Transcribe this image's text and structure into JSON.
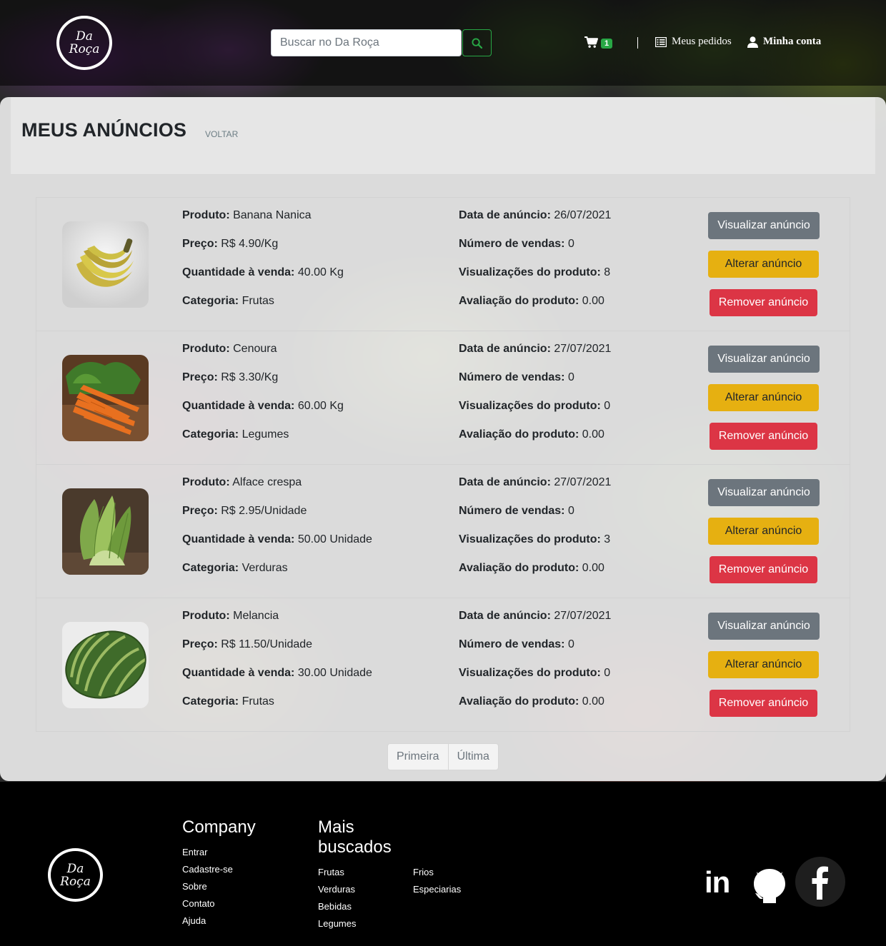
{
  "brand": {
    "line1": "Da",
    "line2": "Roça"
  },
  "header": {
    "search_placeholder": "Buscar no Da Roça",
    "cart_count": "1",
    "orders_label": "Meus pedidos",
    "account_label": "Minha conta"
  },
  "page": {
    "title": "MEUS ANÚNCIOS",
    "back": "VOLTAR"
  },
  "labels": {
    "product": "Produto:",
    "price": "Preço:",
    "quantity": "Quantidade à venda:",
    "category": "Categoria:",
    "date": "Data de anúncio:",
    "sales": "Número de vendas:",
    "views": "Visualizações do produto:",
    "rating": "Avaliação do produto:"
  },
  "buttons": {
    "view": "Visualizar anúncio",
    "edit": "Alterar anúncio",
    "remove": "Remover anúncio"
  },
  "ads": [
    {
      "product": "Banana Nanica",
      "price": "R$ 4.90/Kg",
      "quantity": "40.00 Kg",
      "category": "Frutas",
      "date": "26/07/2021",
      "sales": "0",
      "views": "8",
      "rating": "0.00"
    },
    {
      "product": "Cenoura",
      "price": "R$ 3.30/Kg",
      "quantity": "60.00 Kg",
      "category": "Legumes",
      "date": "27/07/2021",
      "sales": "0",
      "views": "0",
      "rating": "0.00"
    },
    {
      "product": "Alface crespa",
      "price": "R$ 2.95/Unidade",
      "quantity": "50.00 Unidade",
      "category": "Verduras",
      "date": "27/07/2021",
      "sales": "0",
      "views": "3",
      "rating": "0.00"
    },
    {
      "product": "Melancia",
      "price": "R$ 11.50/Unidade",
      "quantity": "30.00 Unidade",
      "category": "Frutas",
      "date": "27/07/2021",
      "sales": "0",
      "views": "0",
      "rating": "0.00"
    }
  ],
  "pagination": {
    "first": "Primeira",
    "last": "Última"
  },
  "footer": {
    "company_title": "Company",
    "company_links": [
      "Entrar",
      "Cadastre-se",
      "Sobre",
      "Contato",
      "Ajuda"
    ],
    "popular_title_1": "Mais",
    "popular_title_2": "buscados",
    "popular_col1": [
      "Frutas",
      "Verduras",
      "Bebidas",
      "Legumes"
    ],
    "popular_col2": [
      "Frios",
      "Especiarias"
    ],
    "linkedin": "in"
  },
  "colors": {
    "success": "#28a745",
    "secondary": "#6c757d",
    "warning": "#e6b011",
    "danger": "#dc3545"
  }
}
